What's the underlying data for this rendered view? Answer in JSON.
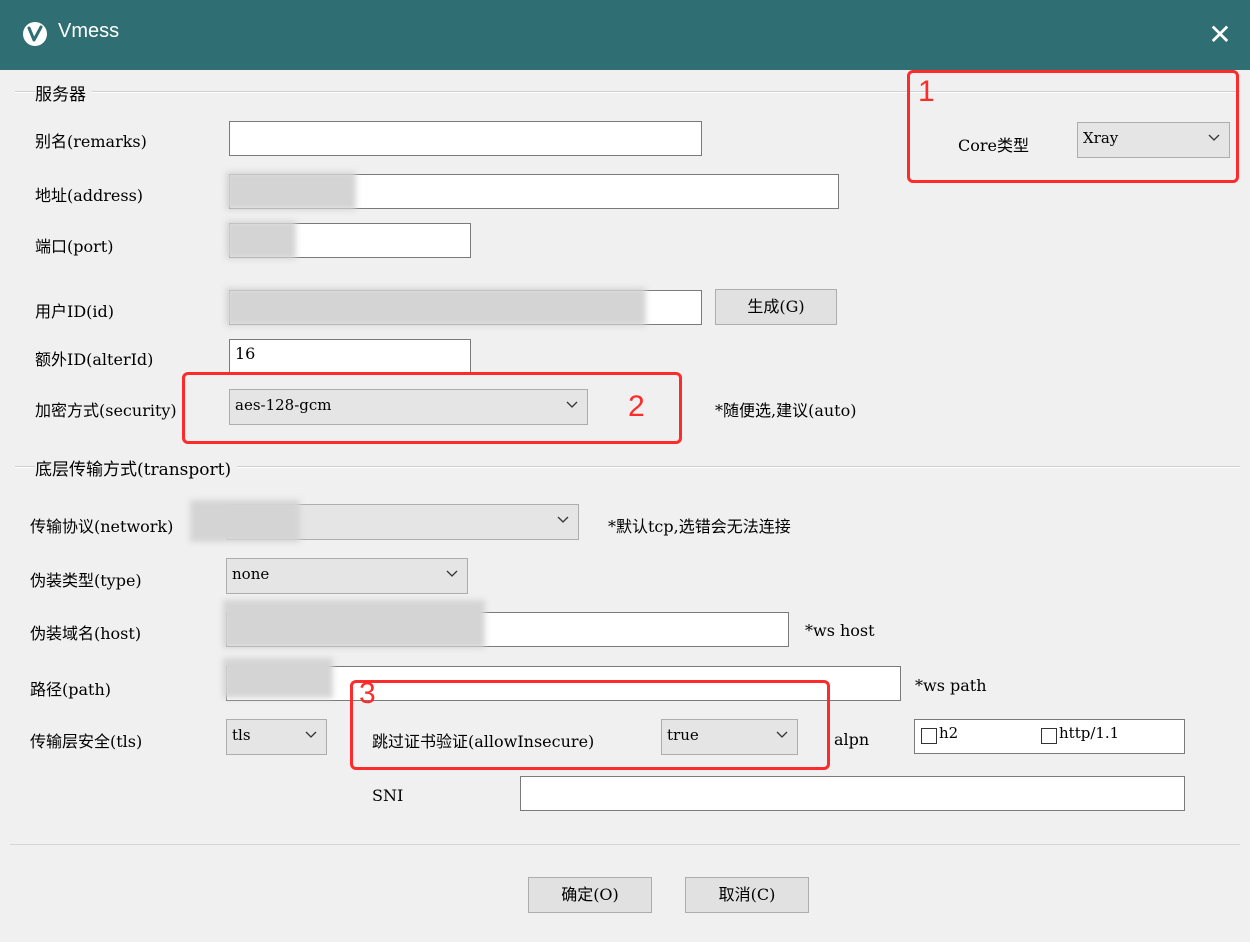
{
  "window": {
    "title": "Vmess",
    "close_glyph": "✕"
  },
  "server": {
    "group_title": "服务器",
    "remarks_label": "别名(remarks)",
    "remarks_value": "",
    "address_label": "地址(address)",
    "port_label": "端口(port)",
    "id_label": "用户ID(id)",
    "generate_button": "生成(G)",
    "alterid_label": "额外ID(alterId)",
    "alterid_value": "16",
    "security_label": "加密方式(security)",
    "security_value": "aes-128-gcm",
    "security_hint": "*随便选,建议(auto)",
    "core_label": "Core类型",
    "core_value": "Xray"
  },
  "transport": {
    "group_title": "底层传输方式(transport)",
    "network_label": "传输协议(network)",
    "network_hint": "*默认tcp,选错会无法连接",
    "type_label": "伪装类型(type)",
    "type_value": "none",
    "host_label": "伪装域名(host)",
    "host_hint": "*ws host",
    "path_label": "路径(path)",
    "path_hint": "*ws path",
    "tls_label": "传输层安全(tls)",
    "tls_value": "tls",
    "allow_insecure_label": "跳过证书验证(allowInsecure)",
    "allow_insecure_value": "true",
    "alpn_label": "alpn",
    "alpn_options": [
      {
        "label": "h2",
        "checked": false
      },
      {
        "label": "http/1.1",
        "checked": false
      }
    ],
    "sni_label": "SNI",
    "sni_value": ""
  },
  "annotations": {
    "n1": "1",
    "n2": "2",
    "n3": "3",
    "color": "#ff2a2a"
  },
  "footer": {
    "ok_button": "确定(O)",
    "cancel_button": "取消(C)"
  },
  "colors": {
    "titlebar": "#2f6f73",
    "window_bg": "#f0f0f0"
  }
}
